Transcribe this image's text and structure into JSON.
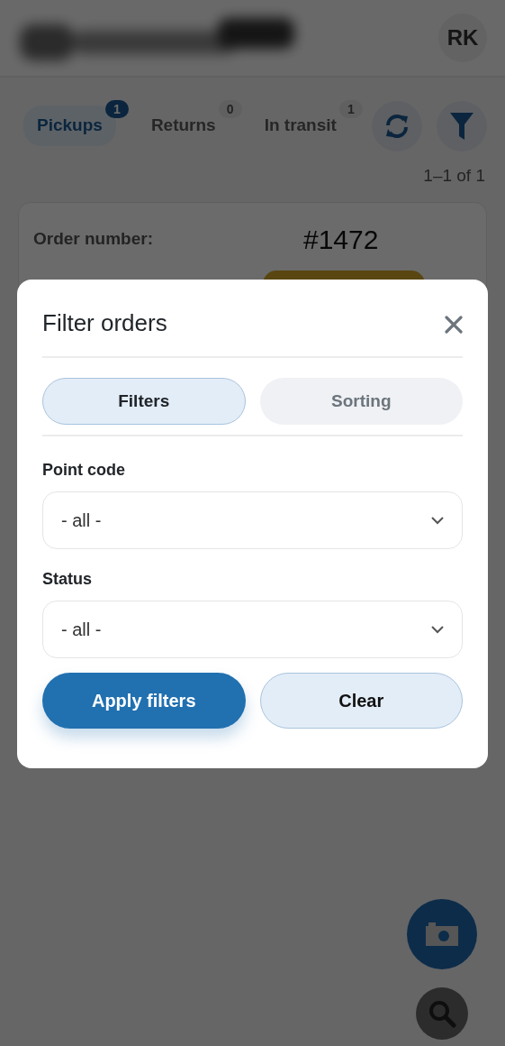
{
  "header": {
    "avatar": "RK"
  },
  "tabs": [
    {
      "label": "Pickups",
      "count": "1",
      "selected": true
    },
    {
      "label": "Returns",
      "count": "0",
      "selected": false
    },
    {
      "label": "In transit",
      "count": "1",
      "selected": false
    }
  ],
  "pagination": "1–1 of 1",
  "order": {
    "label": "Order number:",
    "number": "#1472"
  },
  "dialog": {
    "title": "Filter orders",
    "modes": [
      {
        "label": "Filters",
        "selected": true
      },
      {
        "label": "Sorting",
        "selected": false
      }
    ],
    "fields": [
      {
        "label": "Point code",
        "value": "- all -"
      },
      {
        "label": "Status",
        "value": "- all -"
      }
    ],
    "buttons": [
      {
        "label": "Apply filters",
        "kind": "primary"
      },
      {
        "label": "Clear",
        "kind": "secondary"
      }
    ]
  }
}
